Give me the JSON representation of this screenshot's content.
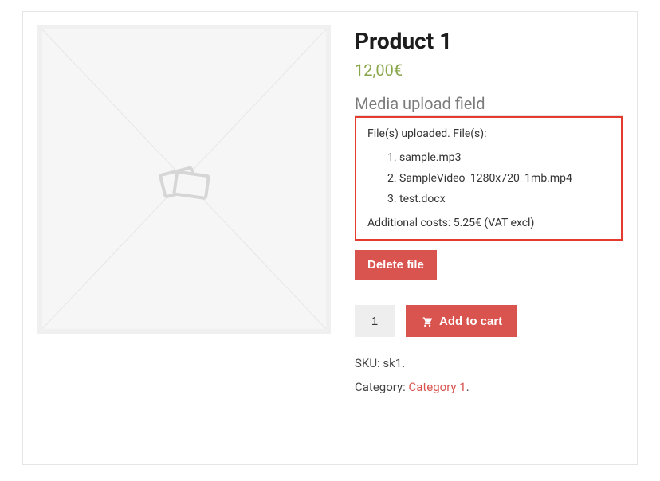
{
  "product": {
    "title": "Product 1",
    "price": "12,00€",
    "media_label": "Media upload field",
    "upload": {
      "status": "File(s) uploaded. File(s):",
      "files": [
        "sample.mp3",
        "SampleVideo_1280x720_1mb.mp4",
        "test.docx"
      ],
      "costs": "Additional costs: 5.25€ (VAT excl)"
    },
    "delete_label": "Delete file",
    "qty": "1",
    "add_to_cart_label": "Add to cart",
    "sku_label": "SKU:",
    "sku_value": "sk1",
    "category_label": "Category:",
    "category_value": "Category 1"
  }
}
